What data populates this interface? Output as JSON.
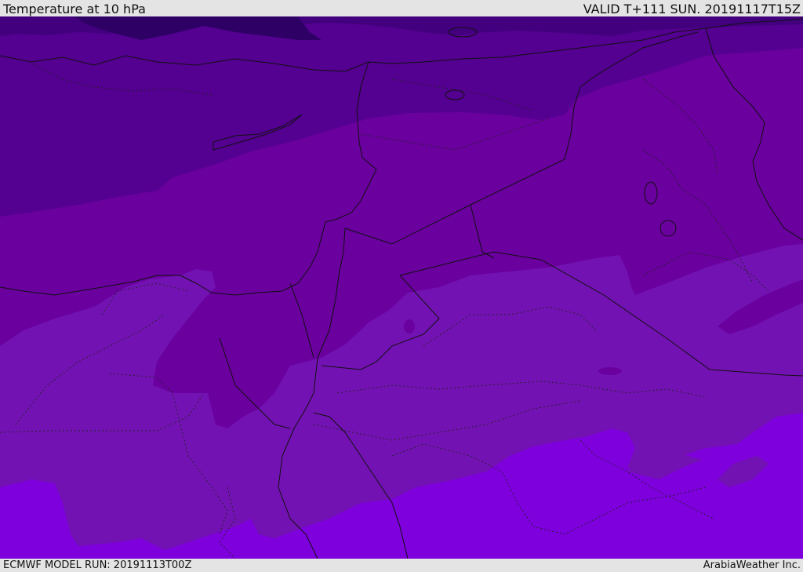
{
  "header": {
    "title": "Temperature at 10 hPa",
    "valid": "VALID T+111 SUN. 20191117T15Z"
  },
  "footer": {
    "model_run": "ECMWF MODEL RUN: 20191113T00Z",
    "credit": "ArabiaWeather Inc."
  },
  "map": {
    "shading_colors": [
      "#2e0066",
      "#42007e",
      "#540090",
      "#6a009e",
      "#7312b2",
      "#7e00dc"
    ]
  }
}
